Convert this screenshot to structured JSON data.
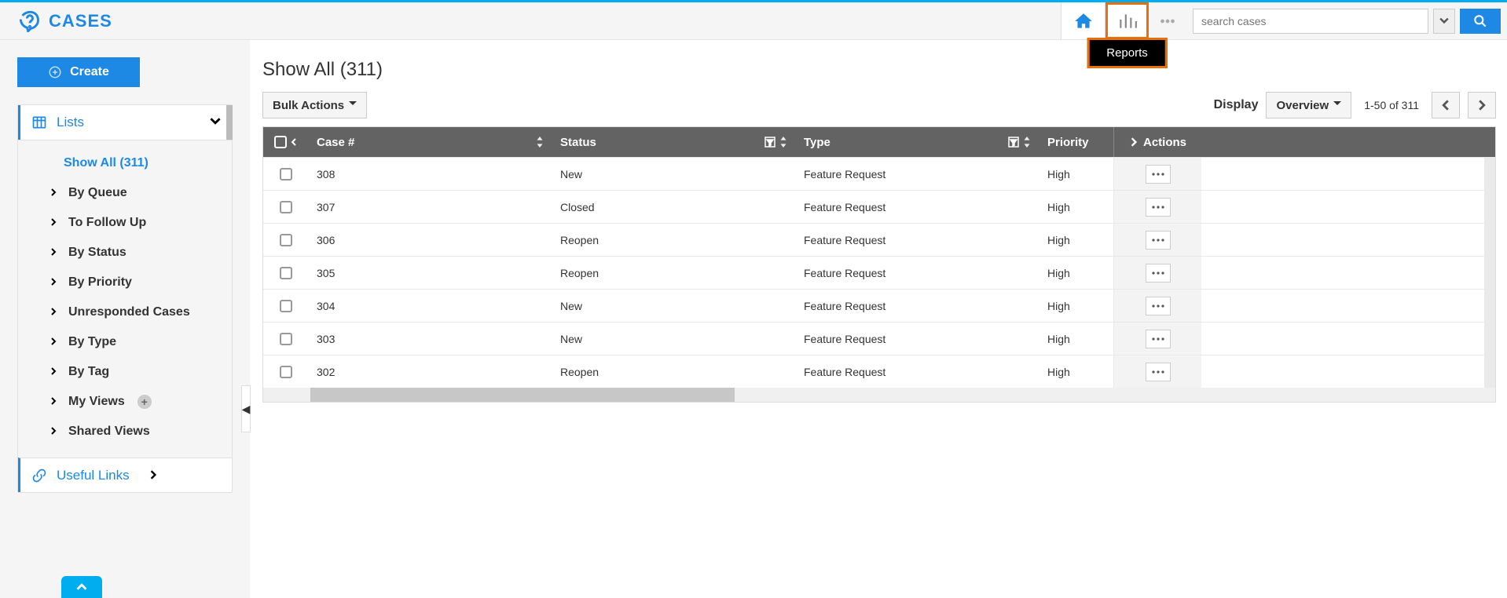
{
  "app": {
    "title": "CASES"
  },
  "header": {
    "tooltip_reports": "Reports",
    "search_placeholder": "search cases"
  },
  "sidebar": {
    "create_label": "Create",
    "lists_label": "Lists",
    "show_all_label": "Show All (311)",
    "items": [
      "By Queue",
      "To Follow Up",
      "By Status",
      "By Priority",
      "Unresponded Cases",
      "By Type",
      "By Tag",
      "My Views",
      "Shared Views"
    ],
    "useful_links_label": "Useful Links"
  },
  "main": {
    "title": "Show All (311)",
    "bulk_actions": "Bulk Actions",
    "display": "Display",
    "overview": "Overview",
    "page_info": "1-50 of 311",
    "columns": {
      "case": "Case #",
      "status": "Status",
      "type": "Type",
      "priority": "Priority",
      "actions": "Actions"
    },
    "rows": [
      {
        "case": "308",
        "status": "New",
        "type": "Feature Request",
        "priority": "High"
      },
      {
        "case": "307",
        "status": "Closed",
        "type": "Feature Request",
        "priority": "High"
      },
      {
        "case": "306",
        "status": "Reopen",
        "type": "Feature Request",
        "priority": "High"
      },
      {
        "case": "305",
        "status": "Reopen",
        "type": "Feature Request",
        "priority": "High"
      },
      {
        "case": "304",
        "status": "New",
        "type": "Feature Request",
        "priority": "High"
      },
      {
        "case": "303",
        "status": "New",
        "type": "Feature Request",
        "priority": "High"
      },
      {
        "case": "302",
        "status": "Reopen",
        "type": "Feature Request",
        "priority": "High"
      }
    ]
  }
}
